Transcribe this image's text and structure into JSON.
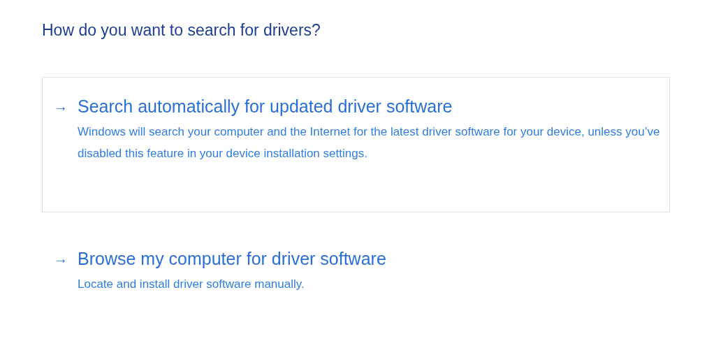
{
  "heading": "How do you want to search for drivers?",
  "options": [
    {
      "arrow": "→",
      "title": "Search automatically for updated driver software",
      "description": "Windows will search your computer and the Internet for the latest driver software for your device, unless you’ve disabled this feature in your device installation settings.",
      "selected": true
    },
    {
      "arrow": "→",
      "title": "Browse my computer for driver software",
      "description": "Locate and install driver software manually.",
      "selected": false
    }
  ]
}
